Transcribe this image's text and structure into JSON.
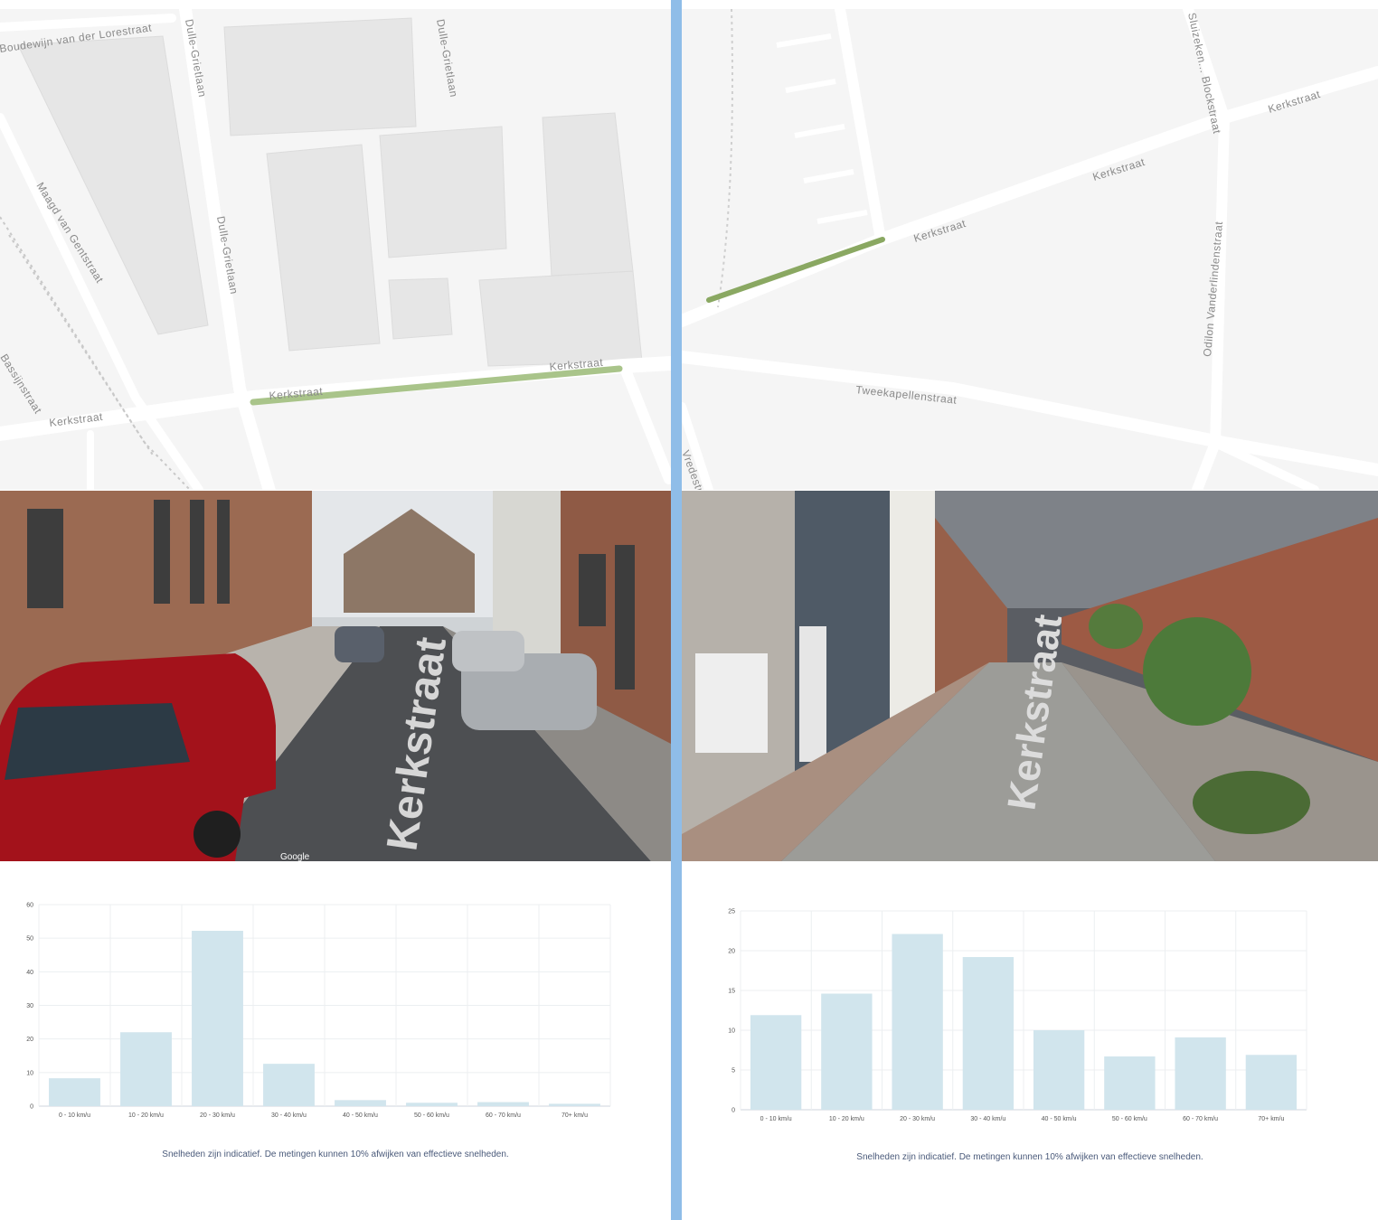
{
  "left": {
    "map": {
      "street_labels": [
        "Boudewijn van der Lorestraat",
        "Dulle-Grietlaan",
        "Dulle-Grietlaan",
        "Dulle-Grietlaan",
        "Maagd van Gentstraat",
        "Bassijnstraat",
        "Kerkstraat",
        "Kerkstraat",
        "Kerkstraat"
      ],
      "highlight_color": "#a9c48a"
    },
    "streetview": {
      "road_text": "Kerkstraat",
      "watermark": "Google"
    },
    "chart_data": {
      "type": "bar",
      "categories": [
        "0 - 10 km/u",
        "10 - 20 km/u",
        "20 - 30 km/u",
        "30 - 40 km/u",
        "40 - 50 km/u",
        "50 - 60 km/u",
        "60 - 70 km/u",
        "70+ km/u"
      ],
      "values": [
        8.3,
        22,
        52.2,
        12.6,
        1.8,
        1.0,
        1.2,
        0.7
      ],
      "ylim": [
        0,
        60
      ],
      "yticks": [
        0,
        10,
        20,
        30,
        40,
        50,
        60
      ],
      "bar_color": "#d1e5ed",
      "grid": true,
      "title": "",
      "xlabel": "",
      "ylabel": ""
    },
    "footnote": "Snelheden zijn indicatief. De metingen kunnen 10% afwijken van effectieve snelheden."
  },
  "right": {
    "map": {
      "street_labels": [
        "Kerkstraat",
        "Kerkstraat",
        "Kerkstraat",
        "Tweekapellenstraat",
        "Odilon Vanderlindenstraat",
        "Sluizeken... Blockstraat",
        "Vredestraat"
      ],
      "highlight_color": "#8aa862"
    },
    "streetview": {
      "road_text": "Kerkstraat"
    },
    "chart_data": {
      "type": "bar",
      "categories": [
        "0 - 10 km/u",
        "10 - 20 km/u",
        "20 - 30 km/u",
        "30 - 40 km/u",
        "40 - 50 km/u",
        "50 - 60 km/u",
        "60 - 70 km/u",
        "70+ km/u"
      ],
      "values": [
        11.9,
        14.6,
        22.1,
        19.2,
        10.0,
        6.7,
        9.1,
        6.9
      ],
      "ylim": [
        0,
        25
      ],
      "yticks": [
        0,
        5,
        10,
        15,
        20,
        25
      ],
      "bar_color": "#d1e5ed",
      "grid": true,
      "title": "",
      "xlabel": "",
      "ylabel": ""
    },
    "footnote": "Snelheden zijn indicatief. De metingen kunnen 10% afwijken van effectieve snelheden."
  }
}
